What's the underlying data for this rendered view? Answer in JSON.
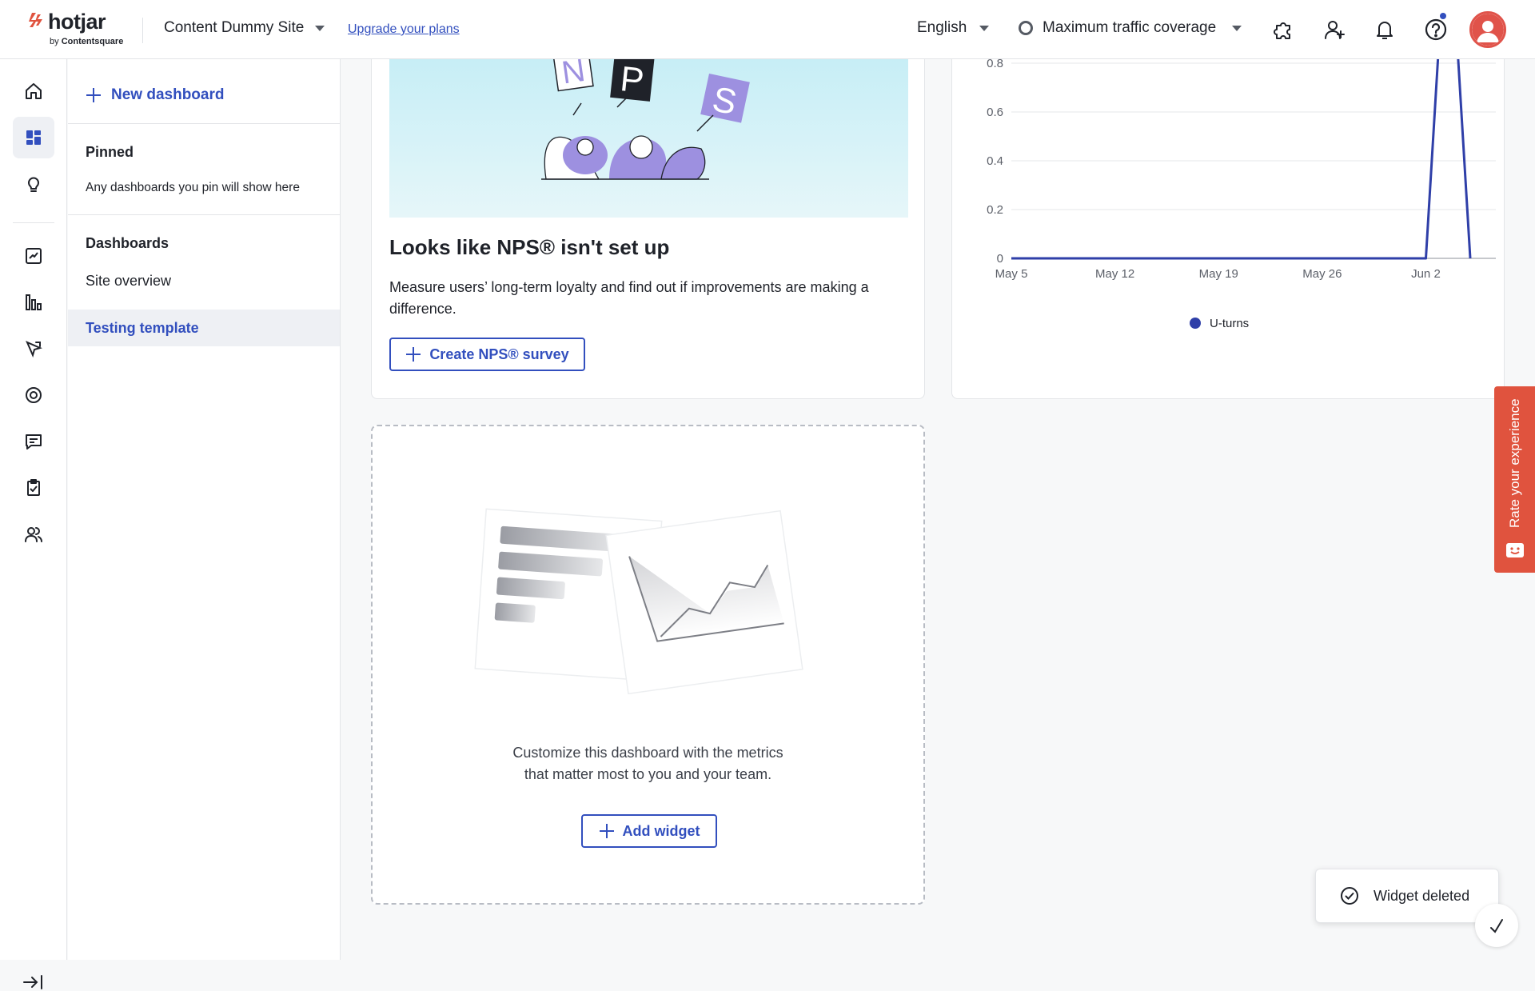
{
  "brand": {
    "name": "hotjar",
    "byline_prefix": "by",
    "byline_company": "Contentsquare"
  },
  "header": {
    "site_name": "Content Dummy Site",
    "upgrade_label": "Upgrade your plans",
    "language": "English",
    "traffic": "Maximum traffic coverage",
    "icons": [
      "integrations-icon",
      "invite-user-icon",
      "bell-icon",
      "help-icon",
      "avatar"
    ]
  },
  "rail": {
    "items": [
      "home-icon",
      "dashboards-icon",
      "insights-icon",
      "trends-icon",
      "funnels-icon",
      "heatmaps-icon",
      "recordings-icon",
      "feedback-icon",
      "surveys-icon",
      "interviews-icon"
    ],
    "active": "dashboards-icon"
  },
  "panel": {
    "new_dashboard": "New dashboard",
    "pinned_title": "Pinned",
    "pinned_note": "Any dashboards you pin will show here",
    "dashboards_title": "Dashboards",
    "dashboards": [
      {
        "label": "Site overview",
        "selected": false
      },
      {
        "label": "Testing template",
        "selected": true
      }
    ]
  },
  "nps": {
    "hero_letters": [
      "N",
      "P",
      "S"
    ],
    "title": "Looks like NPS® isn't set up",
    "description": "Measure users’ long-term loyalty and find out if improvements are making a difference.",
    "button": "Create NPS® survey"
  },
  "chart_data": {
    "type": "line",
    "x": [
      "May 5",
      "May 12",
      "May 19",
      "May 26",
      "Jun 2"
    ],
    "y_ticks": [
      "0",
      "0.2",
      "0.4",
      "0.6",
      "0.8"
    ],
    "ylim": [
      0,
      0.8
    ],
    "series": [
      {
        "name": "U-turns",
        "color": "#2f3fa8",
        "points": [
          [
            0,
            0
          ],
          [
            28,
            0
          ],
          [
            29,
            1
          ],
          [
            30,
            1
          ],
          [
            31,
            0
          ]
        ]
      }
    ],
    "x_tick_days": [
      0,
      7,
      14,
      21,
      28
    ],
    "x_span_days": 31,
    "grid": true,
    "legend": "bottom"
  },
  "add_widget": {
    "text_line1": "Customize this dashboard with the metrics",
    "text_line2": "that matter most to you and your team.",
    "button": "Add widget"
  },
  "feedback_tab": {
    "label": "Rate your experience"
  },
  "toast": {
    "message": "Widget deleted"
  },
  "colors": {
    "accent": "#324fbe",
    "feedback": "#e0533e",
    "avatar_ring": "#e0534a"
  }
}
